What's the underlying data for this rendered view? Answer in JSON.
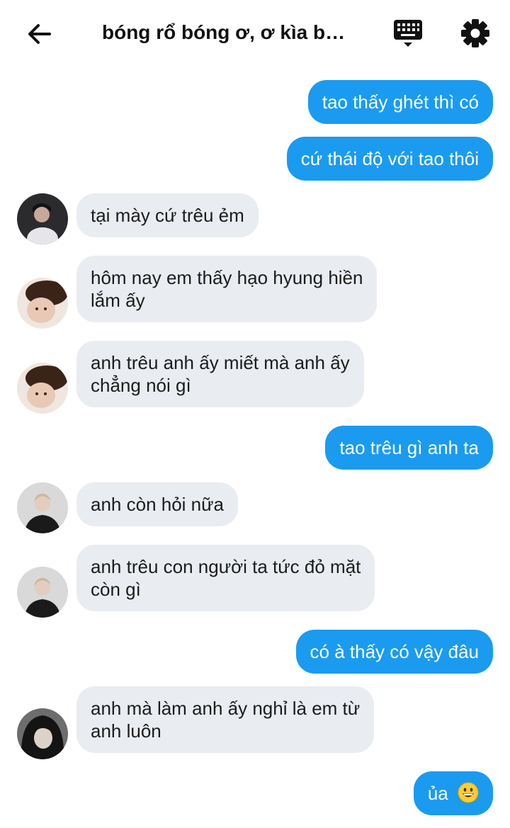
{
  "header": {
    "title": "bóng rổ bóng ơ, ơ kìa b…",
    "icons": [
      "back-arrow-icon",
      "keyboard-icon",
      "gear-icon"
    ]
  },
  "colors": {
    "sent_bubble": "#1a9bf0",
    "received_bubble": "#e9ecf0",
    "sent_text": "#ffffff",
    "received_text": "#1c1c1c"
  },
  "messages": [
    {
      "side": "me",
      "lines": [
        "tao thấy ghét thì có"
      ]
    },
    {
      "side": "me",
      "lines": [
        "cứ thái độ với tao thôi"
      ]
    },
    {
      "side": "them",
      "avatar": "avatar-1",
      "lines": [
        "tại mày cứ trêu ẻm"
      ]
    },
    {
      "side": "them",
      "avatar": "avatar-2",
      "lines": [
        "hôm nay em thấy hạo hyung hiền",
        "lắm ấy"
      ]
    },
    {
      "side": "them",
      "avatar": "avatar-2",
      "lines": [
        "anh trêu anh ấy miết mà anh ấy",
        "chẳng nói gì"
      ]
    },
    {
      "side": "me",
      "lines": [
        "tao trêu gì anh ta"
      ]
    },
    {
      "side": "them",
      "avatar": "avatar-3",
      "lines": [
        "anh còn hỏi nữa"
      ]
    },
    {
      "side": "them",
      "avatar": "avatar-3",
      "lines": [
        "anh trêu con người ta tức đỏ mặt",
        "còn gì"
      ]
    },
    {
      "side": "me",
      "lines": [
        "có à thấy có vậy đâu"
      ]
    },
    {
      "side": "them",
      "avatar": "avatar-4",
      "lines": [
        "anh mà làm anh ấy nghỉ là em từ",
        "anh luôn"
      ]
    },
    {
      "side": "me",
      "lines": [
        "ủa"
      ],
      "emoji": "grinning-face-emoji"
    }
  ]
}
